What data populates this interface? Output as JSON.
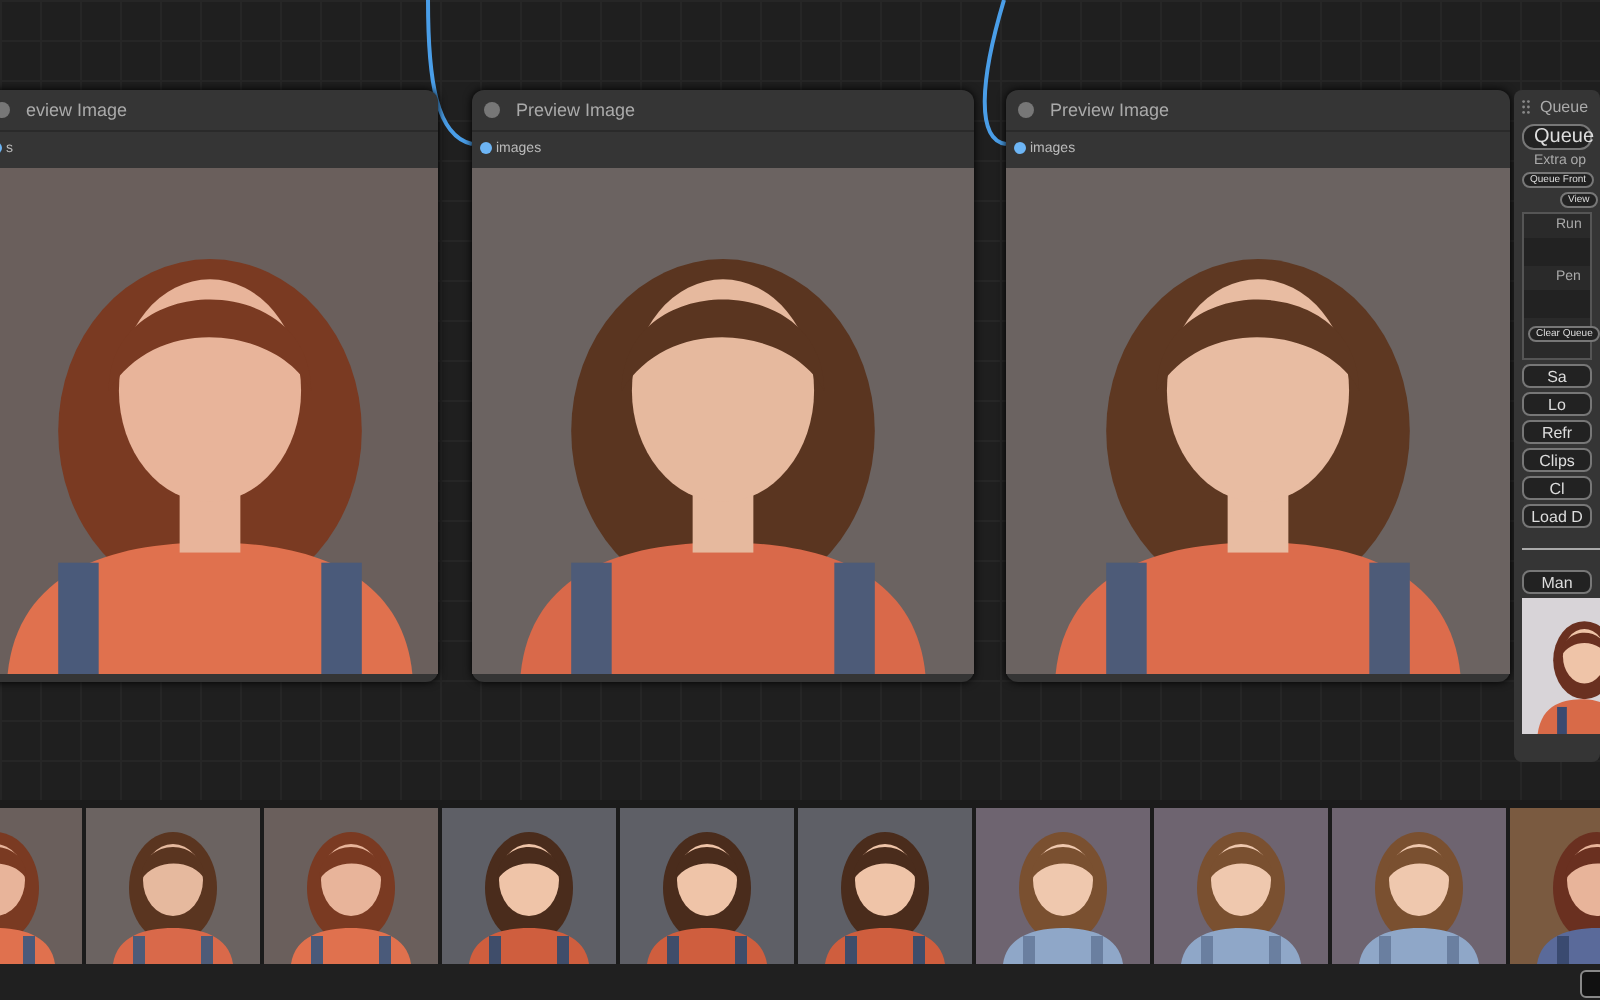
{
  "nodes": [
    {
      "title": "eview Image",
      "input": "s",
      "image": {
        "kind": "picture"
      }
    },
    {
      "title": "Preview Image",
      "input": "images",
      "image": {
        "kind": "picture"
      }
    },
    {
      "title": "Preview Image",
      "input": "images",
      "image": {
        "kind": "picture"
      }
    }
  ],
  "queue_panel": {
    "title": "Queue",
    "queue_button": "Queue",
    "extra_options": "Extra op",
    "small_buttons": [
      "Queue Front",
      "View"
    ],
    "running": "Run",
    "pending": "Pen",
    "clear_button": "Clear Queue",
    "buttons": [
      "Sa",
      "Lo",
      "Refr",
      "Clips",
      "Cl",
      "Load D"
    ],
    "manager_button": "Man",
    "preview": {
      "kind": "picture"
    }
  },
  "gallery": [
    {
      "kind": "picture"
    },
    {
      "kind": "picture"
    },
    {
      "kind": "picture"
    },
    {
      "kind": "picture"
    },
    {
      "kind": "picture"
    },
    {
      "kind": "picture"
    },
    {
      "kind": "picture"
    },
    {
      "kind": "picture"
    },
    {
      "kind": "picture"
    },
    {
      "kind": "picture"
    }
  ]
}
